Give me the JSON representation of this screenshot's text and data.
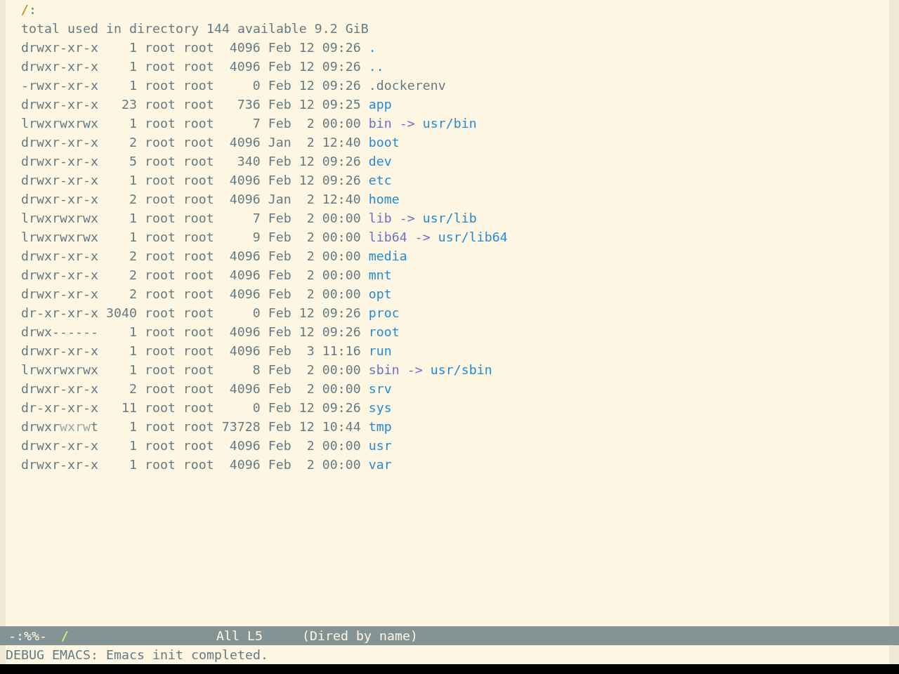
{
  "buffer": {
    "header": {
      "path": "/",
      "suffix": ":"
    },
    "summary": "total used in directory 144 available 9.2 GiB",
    "rows": [
      {
        "kind": "directory",
        "perms": [
          {
            "text": "drwxr-xr-x",
            "faded": false
          }
        ],
        "links": "1",
        "owner": "root",
        "group": "root",
        "size": "4096",
        "month": "Feb",
        "day": "12",
        "time": "09:26",
        "name": "."
      },
      {
        "kind": "directory",
        "perms": [
          {
            "text": "drwxr-xr-x",
            "faded": false
          }
        ],
        "links": "1",
        "owner": "root",
        "group": "root",
        "size": "4096",
        "month": "Feb",
        "day": "12",
        "time": "09:26",
        "name": ".."
      },
      {
        "kind": "file",
        "perms": [
          {
            "text": "-rwxr-xr-x",
            "faded": false
          }
        ],
        "links": "1",
        "owner": "root",
        "group": "root",
        "size": "0",
        "month": "Feb",
        "day": "12",
        "time": "09:26",
        "name": ".dockerenv"
      },
      {
        "kind": "directory",
        "perms": [
          {
            "text": "drwxr-xr-x",
            "faded": false
          }
        ],
        "links": "23",
        "owner": "root",
        "group": "root",
        "size": "736",
        "month": "Feb",
        "day": "12",
        "time": "09:25",
        "name": "app"
      },
      {
        "kind": "symlink",
        "perms": [
          {
            "text": "lrwxrwxrwx",
            "faded": false
          }
        ],
        "links": "1",
        "owner": "root",
        "group": "root",
        "size": "7",
        "month": "Feb",
        "day": "2",
        "time": "00:00",
        "name": "bin",
        "arrow": "->",
        "target": "usr/bin"
      },
      {
        "kind": "directory",
        "perms": [
          {
            "text": "drwxr-xr-x",
            "faded": false
          }
        ],
        "links": "2",
        "owner": "root",
        "group": "root",
        "size": "4096",
        "month": "Jan",
        "day": "2",
        "time": "12:40",
        "name": "boot"
      },
      {
        "kind": "directory",
        "perms": [
          {
            "text": "drwxr-xr-x",
            "faded": false
          }
        ],
        "links": "5",
        "owner": "root",
        "group": "root",
        "size": "340",
        "month": "Feb",
        "day": "12",
        "time": "09:26",
        "name": "dev"
      },
      {
        "kind": "directory",
        "perms": [
          {
            "text": "drwxr-xr-x",
            "faded": false
          }
        ],
        "links": "1",
        "owner": "root",
        "group": "root",
        "size": "4096",
        "month": "Feb",
        "day": "12",
        "time": "09:26",
        "name": "etc"
      },
      {
        "kind": "directory",
        "perms": [
          {
            "text": "drwxr-xr-x",
            "faded": false
          }
        ],
        "links": "2",
        "owner": "root",
        "group": "root",
        "size": "4096",
        "month": "Jan",
        "day": "2",
        "time": "12:40",
        "name": "home"
      },
      {
        "kind": "symlink",
        "perms": [
          {
            "text": "lrwxrwxrwx",
            "faded": false
          }
        ],
        "links": "1",
        "owner": "root",
        "group": "root",
        "size": "7",
        "month": "Feb",
        "day": "2",
        "time": "00:00",
        "name": "lib",
        "arrow": "->",
        "target": "usr/lib"
      },
      {
        "kind": "symlink",
        "perms": [
          {
            "text": "lrwxrwxrwx",
            "faded": false
          }
        ],
        "links": "1",
        "owner": "root",
        "group": "root",
        "size": "9",
        "month": "Feb",
        "day": "2",
        "time": "00:00",
        "name": "lib64",
        "arrow": "->",
        "target": "usr/lib64"
      },
      {
        "kind": "directory",
        "perms": [
          {
            "text": "drwxr-xr-x",
            "faded": false
          }
        ],
        "links": "2",
        "owner": "root",
        "group": "root",
        "size": "4096",
        "month": "Feb",
        "day": "2",
        "time": "00:00",
        "name": "media"
      },
      {
        "kind": "directory",
        "perms": [
          {
            "text": "drwxr-xr-x",
            "faded": false
          }
        ],
        "links": "2",
        "owner": "root",
        "group": "root",
        "size": "4096",
        "month": "Feb",
        "day": "2",
        "time": "00:00",
        "name": "mnt"
      },
      {
        "kind": "directory",
        "perms": [
          {
            "text": "drwxr-xr-x",
            "faded": false
          }
        ],
        "links": "2",
        "owner": "root",
        "group": "root",
        "size": "4096",
        "month": "Feb",
        "day": "2",
        "time": "00:00",
        "name": "opt"
      },
      {
        "kind": "directory",
        "perms": [
          {
            "text": "dr-xr-xr-x",
            "faded": false
          }
        ],
        "links": "3040",
        "owner": "root",
        "group": "root",
        "size": "0",
        "month": "Feb",
        "day": "12",
        "time": "09:26",
        "name": "proc"
      },
      {
        "kind": "directory",
        "perms": [
          {
            "text": "drwx------",
            "faded": false
          }
        ],
        "links": "1",
        "owner": "root",
        "group": "root",
        "size": "4096",
        "month": "Feb",
        "day": "12",
        "time": "09:26",
        "name": "root"
      },
      {
        "kind": "directory",
        "perms": [
          {
            "text": "drwxr-xr-x",
            "faded": false
          }
        ],
        "links": "1",
        "owner": "root",
        "group": "root",
        "size": "4096",
        "month": "Feb",
        "day": "3",
        "time": "11:16",
        "name": "run"
      },
      {
        "kind": "symlink",
        "perms": [
          {
            "text": "lrwxrwxrwx",
            "faded": false
          }
        ],
        "links": "1",
        "owner": "root",
        "group": "root",
        "size": "8",
        "month": "Feb",
        "day": "2",
        "time": "00:00",
        "name": "sbin",
        "arrow": "->",
        "target": "usr/sbin"
      },
      {
        "kind": "directory",
        "perms": [
          {
            "text": "drwxr-xr-x",
            "faded": false
          }
        ],
        "links": "2",
        "owner": "root",
        "group": "root",
        "size": "4096",
        "month": "Feb",
        "day": "2",
        "time": "00:00",
        "name": "srv"
      },
      {
        "kind": "directory",
        "perms": [
          {
            "text": "dr-xr-xr-x",
            "faded": false
          }
        ],
        "links": "11",
        "owner": "root",
        "group": "root",
        "size": "0",
        "month": "Feb",
        "day": "12",
        "time": "09:26",
        "name": "sys"
      },
      {
        "kind": "directory",
        "perms": [
          {
            "text": "drwxr",
            "faded": false
          },
          {
            "text": "wxrw",
            "faded": true
          },
          {
            "text": "t",
            "faded": false
          }
        ],
        "links": "1",
        "owner": "root",
        "group": "root",
        "size": "73728",
        "month": "Feb",
        "day": "12",
        "time": "10:44",
        "name": "tmp"
      },
      {
        "kind": "directory",
        "perms": [
          {
            "text": "drwxr-xr-x",
            "faded": false
          }
        ],
        "links": "1",
        "owner": "root",
        "group": "root",
        "size": "4096",
        "month": "Feb",
        "day": "2",
        "time": "00:00",
        "name": "usr"
      },
      {
        "kind": "directory",
        "perms": [
          {
            "text": "drwxr-xr-x",
            "faded": false
          }
        ],
        "links": "1",
        "owner": "root",
        "group": "root",
        "size": "4096",
        "month": "Feb",
        "day": "2",
        "time": "00:00",
        "name": "var"
      }
    ]
  },
  "mode_line": {
    "status": "-:%%-",
    "buffer_name": "/",
    "position": "All L5",
    "mode": "(Dired by name)"
  },
  "echo_area": {
    "message": "DEBUG EMACS: Emacs init completed."
  }
}
